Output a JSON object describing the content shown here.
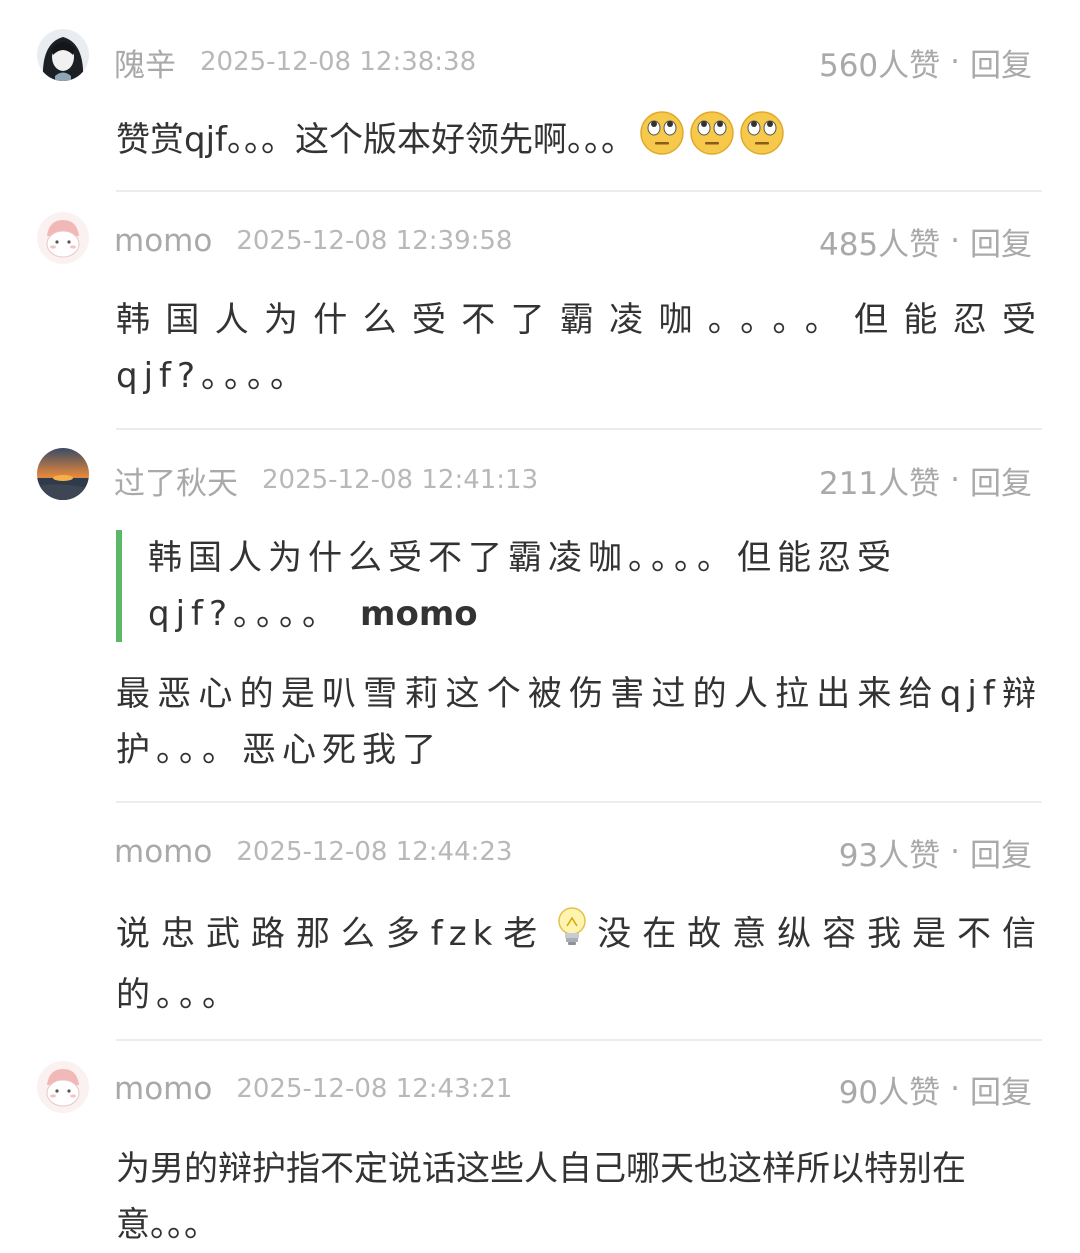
{
  "comments": [
    {
      "username": "隗辛",
      "timestamp": "2025-12-08 12:38:38",
      "likes": "560人赞",
      "reply": "回复",
      "separator": "·",
      "text": "赞赏qjf。。。这个版本好领先啊。。。",
      "emoji_count": 3,
      "emoji": "face-with-rolling-eyes-icon"
    },
    {
      "username": "momo",
      "timestamp": "2025-12-08 12:39:58",
      "likes": "485人赞",
      "reply": "回复",
      "separator": "·",
      "text": "韩国人为什么受不了霸凌咖。。。。但能忍受qjf?。。。。"
    },
    {
      "username": "过了秋天",
      "timestamp": "2025-12-08 12:41:13",
      "likes": "211人赞",
      "reply": "回复",
      "separator": "·",
      "quote": {
        "text": "韩国人为什么受不了霸凌咖。。。。但能忍受qjf?。。。。",
        "author": "momo"
      },
      "text": "最恶心的是叭雪莉这个被伤害过的人拉出来给qjf辩护。。。恶心死我了"
    },
    {
      "username": "momo",
      "timestamp": "2025-12-08 12:44:23",
      "likes": "93人赞",
      "reply": "回复",
      "separator": "·",
      "text_before": "说忠武路那么多fzk老",
      "emoji": "light-bulb-icon",
      "text_after": "没在故意纵容我是不信的。。。"
    },
    {
      "username": "momo",
      "timestamp": "2025-12-08 12:43:21",
      "likes": "90人赞",
      "reply": "回复",
      "separator": "·",
      "text": "为男的辩护指不定说话这些人自己哪天也这样所以特别在意。。。"
    }
  ],
  "colors": {
    "meta_text": "#a9a9a9",
    "body_text": "#333333",
    "divider": "#ececec",
    "quote_bar": "#5ab867"
  }
}
